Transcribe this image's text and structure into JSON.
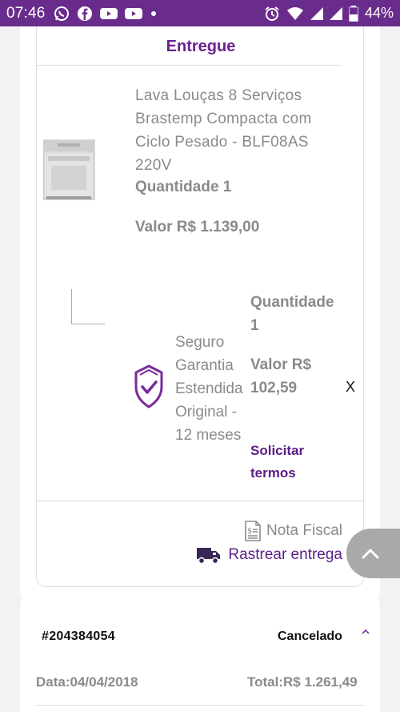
{
  "status_bar": {
    "time": "07:46",
    "battery": "44%",
    "left_icons": [
      "whatsapp-icon",
      "facebook-icon",
      "youtube-icon",
      "youtube-icon",
      "dot-icon"
    ],
    "right_icons": [
      "alarm-icon",
      "wifi-icon",
      "signal-icon",
      "signal-icon",
      "battery-icon"
    ]
  },
  "order": {
    "status": "Entregue",
    "product": {
      "name": "Lava Louças 8 Serviços Brastemp Compacta com Ciclo Pesado - BLF08AS 220V",
      "quantity": "Quantidade 1",
      "price": "Valor R$ 1.139,00"
    },
    "insurance": {
      "name": "Seguro Garantia Estendida Original - 12 meses",
      "quantity": "Quantidade 1",
      "price": "Valor R$ 102,59",
      "terms_link": "Solicitar termos",
      "remove": "X"
    },
    "nota_fiscal": "Nota Fiscal",
    "rastrear": "Rastrear entrega"
  },
  "order2": {
    "id": "#204384054",
    "status": "Cancelado",
    "date": "Data:04/04/2018",
    "total": "Total:R$ 1.261,49"
  },
  "colors": {
    "brand_purple": "#6a2c8c",
    "link_purple": "#5a1d86",
    "muted_text": "#8a8a8a"
  }
}
